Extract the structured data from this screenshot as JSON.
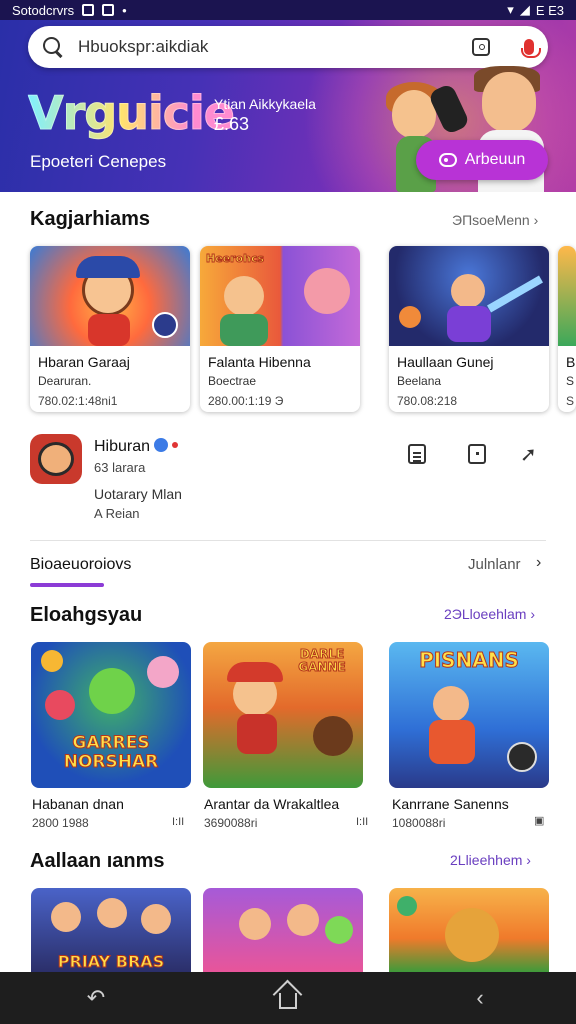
{
  "status_bar": {
    "left_text": "Sotodcrvrs",
    "right_text": "E E3"
  },
  "search": {
    "placeholder": "Hbuokspr:aikdiak"
  },
  "hero": {
    "title": "Vrguicie",
    "tagline_1": "Ytian Aikkykaela",
    "tagline_2": "£.63",
    "subtitle": "Epoeteri Cenepes",
    "button_label": "Arbeuun"
  },
  "section_1": {
    "title": "Kagjarhiams",
    "more": "ЭПsoeMenn ›",
    "cards": [
      {
        "title": "Hbaran Garaaj",
        "subtitle": "Dearuran.",
        "meta": "780.02:1:48ni1",
        "art_label": ""
      },
      {
        "title": "Falanta Hibenna",
        "subtitle": "Boectrae",
        "meta": "280.00:1:19 Э",
        "art_label": "Heerohcs"
      },
      {
        "title": "Haullaan Gunej",
        "subtitle": "Beelana",
        "meta": "780.08:218",
        "art_label": ""
      },
      {
        "title": "B",
        "subtitle": "S",
        "meta": "S",
        "art_label": ""
      }
    ]
  },
  "featured_app": {
    "name": "Hiburan",
    "meta": "63 larara",
    "desc_1": "Uotarary Mlan",
    "desc_2": "A Reian"
  },
  "tab": {
    "label": "Bioaeuoroiovs",
    "more": "Julnlanr"
  },
  "section_2": {
    "title": "Eloahgsyau",
    "more": "2ЭLloeehlam ›",
    "tiles": [
      {
        "title": "Habanan dnan",
        "meta": "2800 1988",
        "end": "I:II",
        "art_label": "GARRES NORSHAR"
      },
      {
        "title": "Arantar da Wrakaltlea",
        "meta": "3690088ri",
        "end": "I:II",
        "art_label": "DARLE GANNE"
      },
      {
        "title": "Kanrrane Sanenns",
        "meta": "1080088ri",
        "end": "▣",
        "art_label": "PISNANS"
      }
    ]
  },
  "section_3": {
    "title": "Aallaan ıanms",
    "more": "2Llieehhem ›",
    "tiles": [
      {
        "art_label": "PRIAY BRAS"
      },
      {
        "art_label": ""
      },
      {
        "art_label": ""
      }
    ]
  },
  "colors": {
    "accent": "#8c3bd6",
    "hero_start": "#2a2fa8",
    "hero_end": "#b03ca6",
    "button": "#b833d6"
  },
  "icons": [
    "search-icon",
    "camera-lens-icon",
    "mic-icon",
    "gamepad-icon",
    "document-icon",
    "frame-icon",
    "share-icon",
    "back-icon",
    "home-icon",
    "recents-icon"
  ]
}
